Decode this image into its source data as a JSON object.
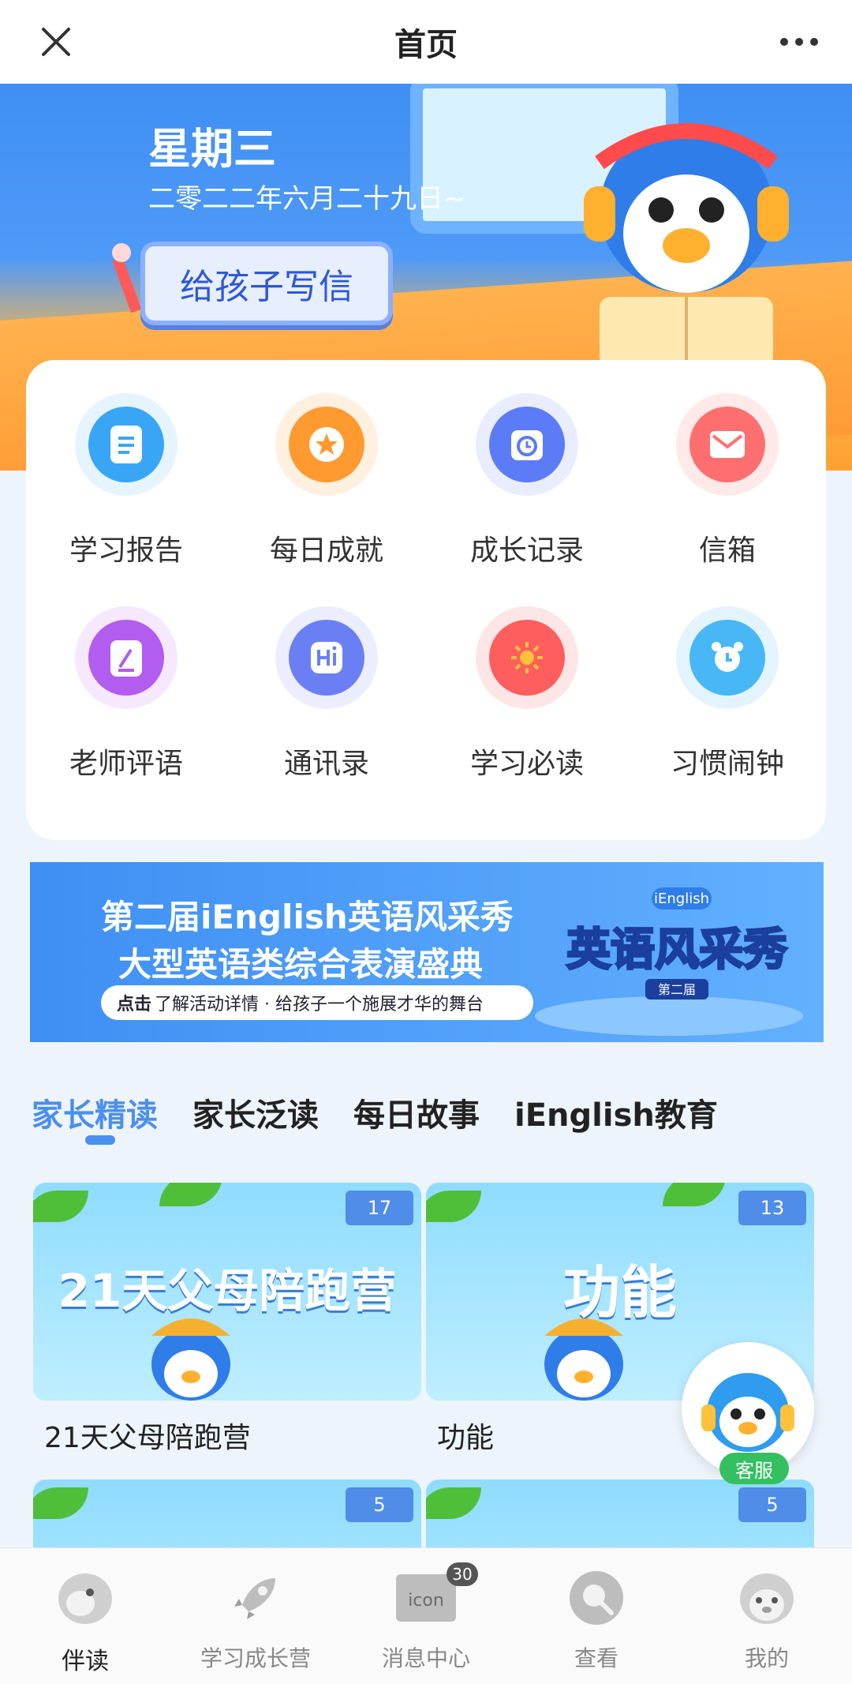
{
  "topbar": {
    "title": "首页"
  },
  "hero": {
    "day": "星期三",
    "date": "二零二二年六月二十九日~",
    "letter_button": "给孩子写信"
  },
  "grid": [
    {
      "label": "学习报告",
      "icon": "report-icon",
      "color": "#39a6f5"
    },
    {
      "label": "每日成就",
      "icon": "star-icon",
      "color": "#ff9a30"
    },
    {
      "label": "成长记录",
      "icon": "clock-icon",
      "color": "#5b7cf6"
    },
    {
      "label": "信箱",
      "icon": "mail-icon",
      "color": "#ff6f6f"
    },
    {
      "label": "老师评语",
      "icon": "note-icon",
      "color": "#b35cf0"
    },
    {
      "label": "通讯录",
      "icon": "hi-icon",
      "color": "#6b7ff5"
    },
    {
      "label": "学习必读",
      "icon": "sun-icon",
      "color": "#ff5e5e"
    },
    {
      "label": "习惯闹钟",
      "icon": "alarm-icon",
      "color": "#48b7f5"
    }
  ],
  "banner": {
    "line1": "第二届iEnglish英语风采秀",
    "line2": "大型英语类综合表演盛典",
    "pill_bold": "点击",
    "pill_text": "了解活动详情 · 给孩子一个施展才华的舞台",
    "logo_tag": "iEnglish",
    "logo_title": "英语风采秀",
    "logo_sub": "第二届"
  },
  "tabs": [
    {
      "label": "家长精读",
      "active": true
    },
    {
      "label": "家长泛读",
      "active": false
    },
    {
      "label": "每日故事",
      "active": false
    },
    {
      "label": "iEnglish教育",
      "active": false
    }
  ],
  "cards": [
    {
      "badge": "17",
      "thumb_title": "21天父母陪跑营",
      "caption": "21天父母陪跑营"
    },
    {
      "badge": "13",
      "thumb_title": "功能",
      "caption": "功能"
    },
    {
      "badge": "5",
      "thumb_title": "",
      "caption": ""
    },
    {
      "badge": "5",
      "thumb_title": "",
      "caption": ""
    }
  ],
  "service": {
    "label": "客服"
  },
  "bottomnav": [
    {
      "label": "伴读",
      "icon": "companion-icon",
      "active": true,
      "badge": ""
    },
    {
      "label": "学习成长营",
      "icon": "rocket-icon",
      "active": false,
      "badge": ""
    },
    {
      "label": "消息中心",
      "icon": "message-icon",
      "active": false,
      "badge": "30",
      "icon_text": "icon"
    },
    {
      "label": "查看",
      "icon": "view-icon",
      "active": false,
      "badge": ""
    },
    {
      "label": "我的",
      "icon": "profile-icon",
      "active": false,
      "badge": ""
    }
  ]
}
